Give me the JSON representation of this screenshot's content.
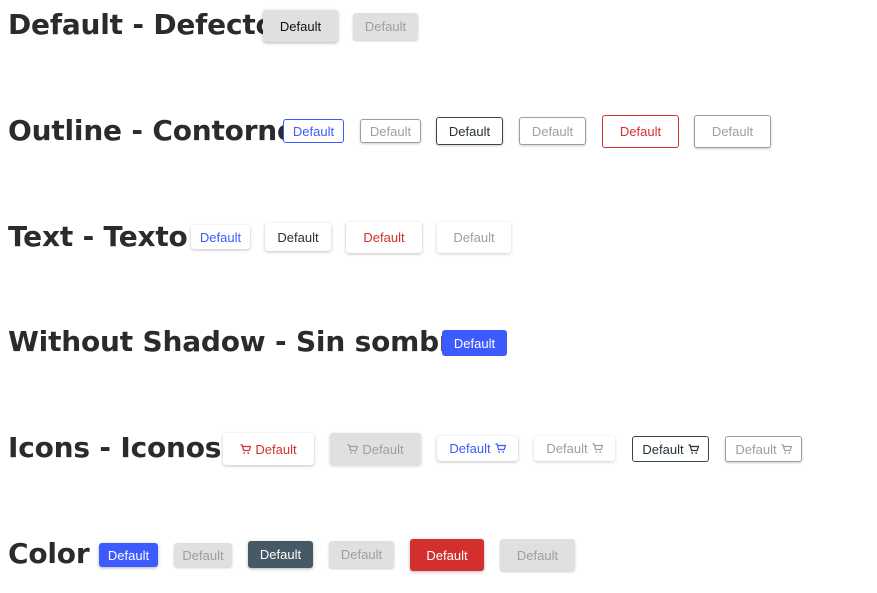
{
  "sections": {
    "default": {
      "title": "Default - Defecto",
      "buttons": [
        "Default",
        "Default"
      ]
    },
    "outline": {
      "title": "Outline - Contorno",
      "buttons": [
        "Default",
        "Default",
        "Default",
        "Default",
        "Default",
        "Default"
      ]
    },
    "text": {
      "title": "Text - Texto",
      "buttons": [
        "Default",
        "Default",
        "Default",
        "Default"
      ]
    },
    "noshadow": {
      "title": "Without Shadow - Sin sombra",
      "buttons": [
        "Default"
      ]
    },
    "icons": {
      "title": "Icons - Iconos",
      "buttons": [
        "Default",
        "Default",
        "Default",
        "Default",
        "Default",
        "Default"
      ],
      "icon": "cart-icon"
    },
    "color": {
      "title": "Color",
      "buttons": [
        "Default",
        "Default",
        "Default",
        "Default",
        "Default",
        "Default"
      ]
    }
  },
  "colors": {
    "primary": "#3d5afe",
    "dark": "#455a64",
    "danger": "#d32f2f",
    "disabled_bg": "#e0e0e0",
    "disabled_text": "#9e9e9e",
    "title_text": "#2b2b2b"
  }
}
